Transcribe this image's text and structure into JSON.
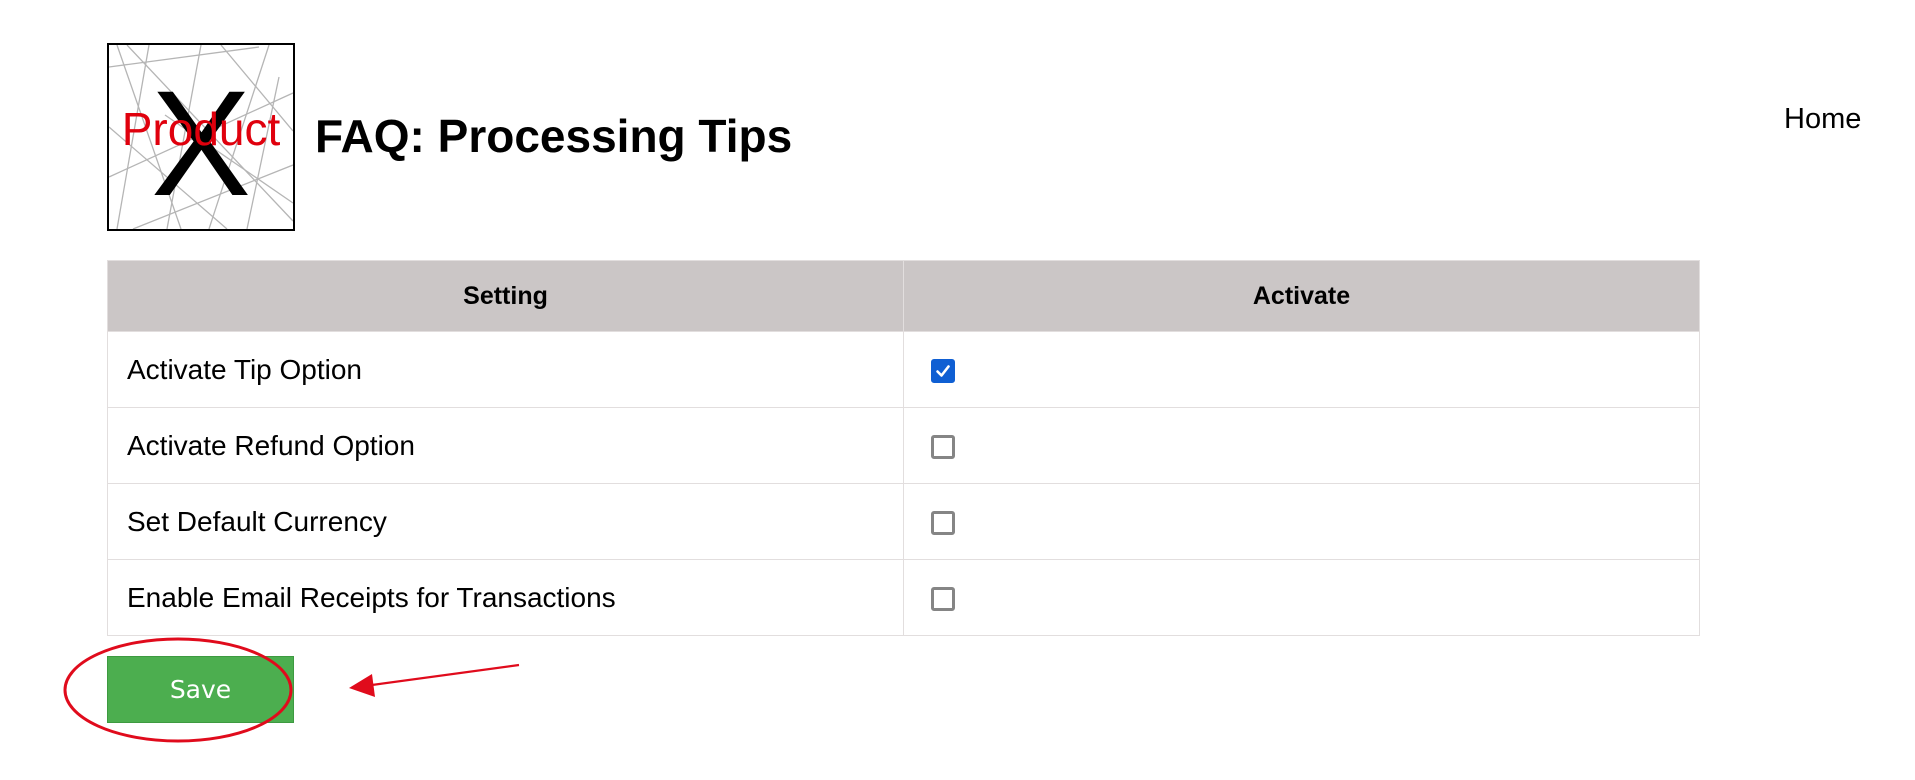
{
  "logo": {
    "word": "Product",
    "letter": "X",
    "word_color": "#e0000d"
  },
  "header": {
    "title": "FAQ: Processing Tips",
    "nav_home": "Home"
  },
  "table": {
    "columns": [
      "Setting",
      "Activate"
    ],
    "rows": [
      {
        "label": "Activate Tip Option",
        "checked": true
      },
      {
        "label": "Activate Refund Option",
        "checked": false
      },
      {
        "label": "Set Default Currency",
        "checked": false
      },
      {
        "label": "Enable Email Receipts for Transactions",
        "checked": false
      }
    ]
  },
  "actions": {
    "save_label": "Save",
    "save_color": "#4cae4f"
  },
  "annotation": {
    "color": "#e00b1c"
  },
  "colors": {
    "header_bg": "#cbc6c6",
    "checkbox_checked": "#0f5fd3"
  }
}
